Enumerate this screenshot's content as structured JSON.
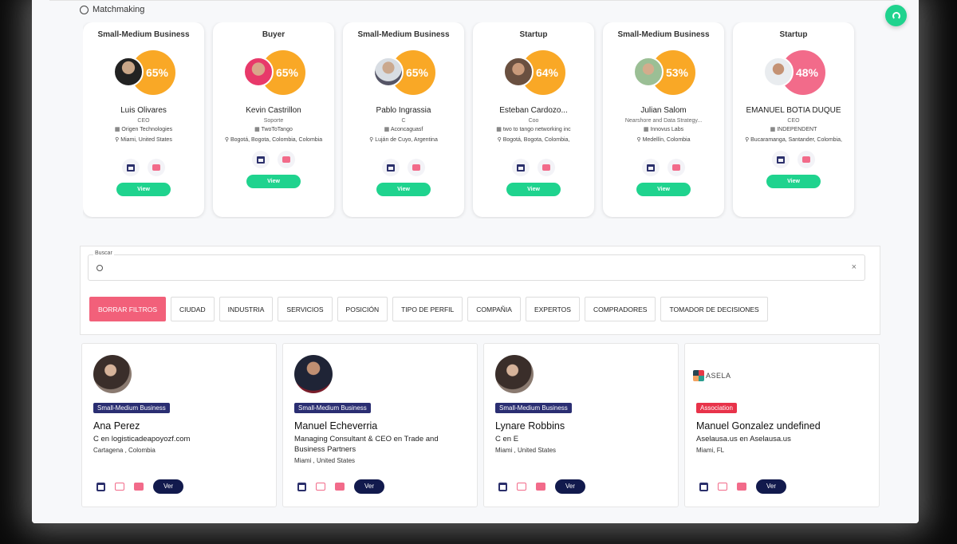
{
  "section": {
    "title": "Matchmaking"
  },
  "colors": {
    "accent_green": "#1fd38e",
    "score_orange": "#f9a826",
    "score_pink": "#f26b8a",
    "badge_navy": "#2a2e72",
    "badge_red": "#e8334a",
    "navy_button": "#121a4d"
  },
  "matches": [
    {
      "type": "Small-Medium Business",
      "score": "65%",
      "score_color": "#f9a826",
      "name": "Luis Olivares",
      "role": "CEO",
      "org": "Origen Technologies",
      "location": "Miami, United States",
      "view_label": "View"
    },
    {
      "type": "Buyer",
      "score": "65%",
      "score_color": "#f9a826",
      "name": "Kevin Castrillon",
      "role": "Soporte",
      "org": "TwoToTango",
      "location": "Bogotá, Bogota, Colombia, Colombia",
      "view_label": "View"
    },
    {
      "type": "Small-Medium Business",
      "score": "65%",
      "score_color": "#f9a826",
      "name": "Pablo Ingrassia",
      "role": "C",
      "org": "Aconcaguasf",
      "location": "Luján de Cuyo, Argentina",
      "view_label": "View"
    },
    {
      "type": "Startup",
      "score": "64%",
      "score_color": "#f9a826",
      "name": "Esteban Cardozo...",
      "role": "Coo",
      "org": "two to tango networking inc",
      "location": "Bogotá, Bogota, Colombia,",
      "view_label": "View"
    },
    {
      "type": "Small-Medium Business",
      "score": "53%",
      "score_color": "#f9a826",
      "name": "Julian Salom",
      "role": "Nearshore and Data Strategy...",
      "org": "Innovus Labs",
      "location": "Medellín, Colombia",
      "view_label": "View"
    },
    {
      "type": "Startup",
      "score": "48%",
      "score_color": "#f26b8a",
      "name": "EMANUEL BOTIA DUQUE",
      "role": "CEO",
      "org": "INDEPENDENT",
      "location": "Bucaramanga, Santander, Colombia,",
      "view_label": "View"
    }
  ],
  "search": {
    "label": "Buscar",
    "placeholder": "",
    "value": "",
    "clear": "×"
  },
  "filters": [
    "BORRAR FILTROS",
    "CIUDAD",
    "INDUSTRIA",
    "SERVICIOS",
    "POSICIÓN",
    "TIPO DE PERFIL",
    "COMPAÑIA",
    "EXPERTOS",
    "COMPRADORES",
    "TOMADOR DE DECISIONES"
  ],
  "results": [
    {
      "badge": "Small-Medium Business",
      "badge_color": "#2a2e72",
      "name": "Ana Perez",
      "title": "C en logisticadeapoyozf.com",
      "location": "Cartagena , Colombia",
      "ver_label": "Ver"
    },
    {
      "badge": "Small-Medium Business",
      "badge_color": "#2a2e72",
      "name": "Manuel Echeverria",
      "title": "Managing Consultant & CEO en Trade and Business Partners",
      "location": "Miami , United States",
      "ver_label": "Ver"
    },
    {
      "badge": "Small-Medium Business",
      "badge_color": "#2a2e72",
      "name": "Lynare Robbins",
      "title": "C en E",
      "location": "Miami , United States",
      "ver_label": "Ver"
    },
    {
      "badge": "Association",
      "badge_color": "#e8334a",
      "name": "Manuel Gonzalez undefined",
      "title": "Aselausa.us en Aselausa.us",
      "location": "Miami, FL",
      "ver_label": "Ver",
      "logo_text": "ASELA"
    }
  ]
}
